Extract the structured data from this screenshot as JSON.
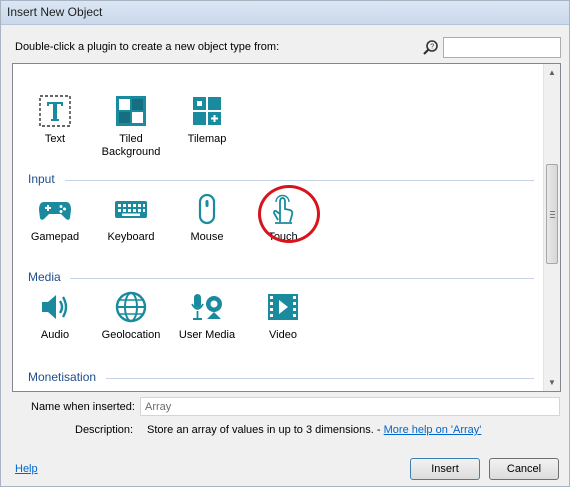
{
  "window": {
    "title": "Insert New Object"
  },
  "instruction": "Double-click a plugin to create a new object type from:",
  "search": {
    "value": "",
    "placeholder": ""
  },
  "top_plugins": [
    {
      "label": "Text",
      "icon": "text-icon"
    },
    {
      "label": "Tiled\nBackground",
      "icon": "tiled-background-icon"
    },
    {
      "label": "Tilemap",
      "icon": "tilemap-icon"
    }
  ],
  "categories": {
    "input": {
      "title": "Input",
      "plugins": [
        {
          "label": "Gamepad",
          "icon": "gamepad-icon"
        },
        {
          "label": "Keyboard",
          "icon": "keyboard-icon"
        },
        {
          "label": "Mouse",
          "icon": "mouse-icon"
        },
        {
          "label": "Touch",
          "icon": "touch-icon"
        }
      ]
    },
    "media": {
      "title": "Media",
      "plugins": [
        {
          "label": "Audio",
          "icon": "audio-icon"
        },
        {
          "label": "Geolocation",
          "icon": "geolocation-icon"
        },
        {
          "label": "User Media",
          "icon": "user-media-icon"
        },
        {
          "label": "Video",
          "icon": "video-icon"
        }
      ]
    },
    "monetisation": {
      "title": "Monetisation"
    }
  },
  "name_field": {
    "label": "Name when inserted:",
    "value": "Array"
  },
  "description": {
    "label": "Description:",
    "text": "Store an array of values in up to 3 dimensions. - ",
    "link": "More help on 'Array'"
  },
  "help_link": "Help",
  "buttons": {
    "insert": "Insert",
    "cancel": "Cancel"
  },
  "colors": {
    "icon_teal": "#1a8a9e",
    "category_blue": "#1f4e8c",
    "highlight_red": "#d8131c"
  }
}
